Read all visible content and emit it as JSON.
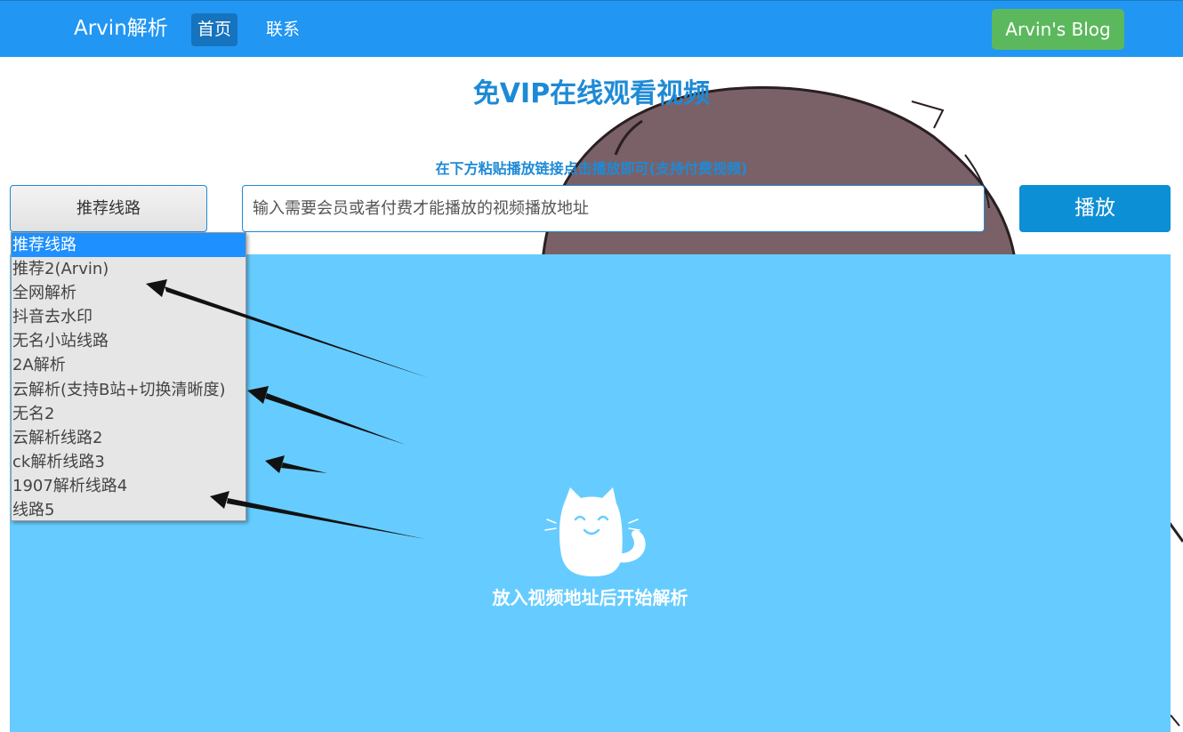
{
  "navbar": {
    "brand": "Arvin解析",
    "links": [
      "首页",
      "联系"
    ],
    "blog_button": "Arvin's Blog"
  },
  "main": {
    "title": "免VIP在线观看视频",
    "subtitle": "在下方粘贴播放链接点击播放即可(支持付费视频)",
    "route_select": "推荐线路",
    "url_input_placeholder": "输入需要会员或者付费才能播放的视频播放地址",
    "play_button": "播放"
  },
  "dropdown": {
    "options": [
      "推荐线路",
      "推荐2(Arvin)",
      "全网解析",
      "抖音去水印",
      "无名小站线路",
      "2A解析",
      "云解析(支持B站+切换清晰度)",
      "无名2",
      "云解析线路2",
      "ck解析线路3",
      "1907解析线路4",
      "线路5"
    ],
    "selected_index": 0
  },
  "player": {
    "placeholder_text": "放入视频地址后开始解析"
  },
  "colors": {
    "navbar": "#2196f3",
    "blog_button": "#5cb85c",
    "accent": "#1e8ad6",
    "play_button": "#0d8fd5",
    "player_bg": "#66ccff",
    "dropdown_selected": "#1e90ff"
  }
}
